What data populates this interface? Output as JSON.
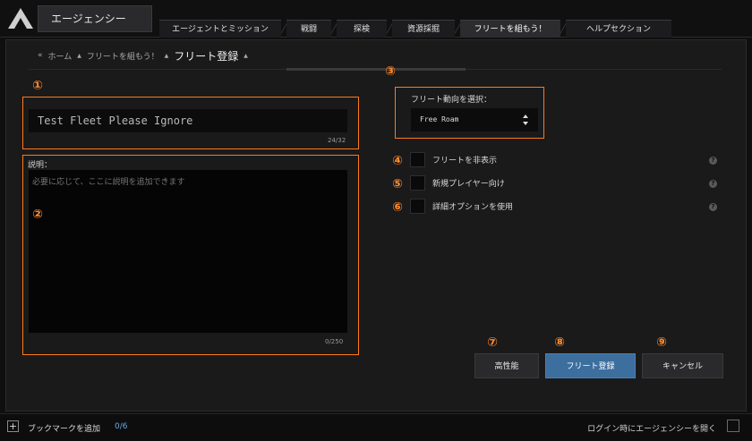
{
  "header": {
    "app_title": "エージェンシー",
    "tabs": [
      {
        "label": "エージェントとミッション"
      },
      {
        "label": "戦闘"
      },
      {
        "label": "探検"
      },
      {
        "label": "資源採掘"
      },
      {
        "label": "フリートを組もう！",
        "active": true
      },
      {
        "label": "ヘルプセクション"
      }
    ]
  },
  "breadcrumb": {
    "back_symbol": "«",
    "home": "ホーム",
    "parent": "フリートを組もう！",
    "current": "フリート登録"
  },
  "form": {
    "fleet_name": "Test Fleet Please Ignore",
    "name_counter": "24/32",
    "description_label": "説明：",
    "description_placeholder": "必要に応じて、ここに説明を追加できます",
    "description_counter": "0/250",
    "motive_label": "フリート動向を選択：",
    "motive_value": "Free Roam",
    "options": [
      {
        "label": "フリートを非表示",
        "checked": false
      },
      {
        "label": "新規プレイヤー向け",
        "checked": false
      },
      {
        "label": "詳細オプションを使用",
        "checked": false
      }
    ],
    "help_glyph": "?"
  },
  "buttons": {
    "advanced": "高性能",
    "register": "フリート登録",
    "cancel": "キャンセル"
  },
  "callouts": [
    "①",
    "②",
    "③",
    "④",
    "⑤",
    "⑥",
    "⑦",
    "⑧",
    "⑨"
  ],
  "bottom": {
    "plus": "+",
    "bookmark_label": "ブックマークを追加",
    "bookmark_count": "0/6",
    "login_label": "ログイン時にエージェンシーを開く"
  },
  "colors": {
    "accent": "#3c6e9e",
    "callout": "#ff8a2a",
    "count": "#6fa6e0"
  }
}
